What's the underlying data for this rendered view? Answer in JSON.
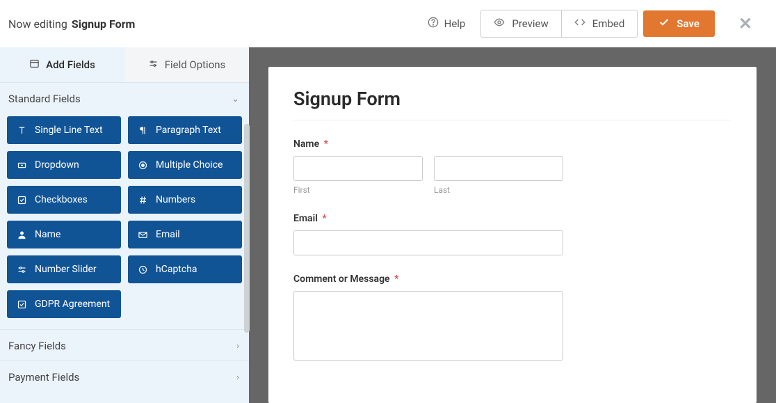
{
  "header": {
    "now_editing": "Now editing",
    "form_name": "Signup Form",
    "help": "Help",
    "preview": "Preview",
    "embed": "Embed",
    "save": "Save"
  },
  "sidebar": {
    "tabs": {
      "add_fields": "Add Fields",
      "field_options": "Field Options"
    },
    "sections": {
      "standard": "Standard Fields",
      "fancy": "Fancy Fields",
      "payment": "Payment Fields"
    },
    "fields": {
      "single_line_text": "Single Line Text",
      "paragraph_text": "Paragraph Text",
      "dropdown": "Dropdown",
      "multiple_choice": "Multiple Choice",
      "checkboxes": "Checkboxes",
      "numbers": "Numbers",
      "name": "Name",
      "email": "Email",
      "number_slider": "Number Slider",
      "hcaptcha": "hCaptcha",
      "gdpr_agreement": "GDPR Agreement"
    }
  },
  "form": {
    "title": "Signup Form",
    "name_label": "Name",
    "first_sublabel": "First",
    "last_sublabel": "Last",
    "email_label": "Email",
    "comment_label": "Comment or Message",
    "required_marker": "*"
  }
}
